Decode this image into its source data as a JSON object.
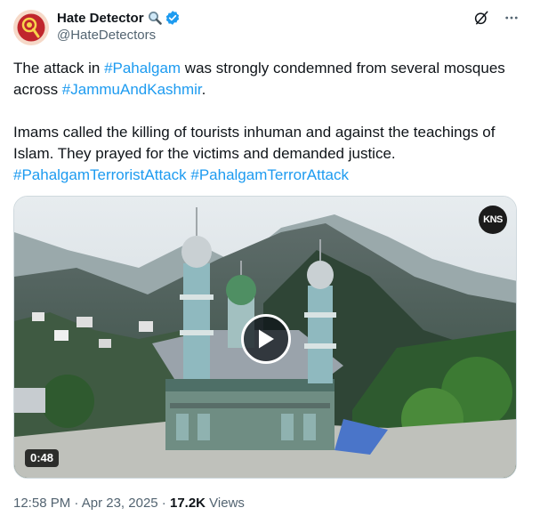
{
  "author": {
    "name": "Hate Detector",
    "handle": "@HateDetectors",
    "name_icon": "magnifier-icon",
    "verified_icon": "verified-badge-icon",
    "avatar_icon": "hate-detector-logo",
    "brand_color": "#c0262d"
  },
  "header_actions": {
    "grok_icon": "grok-icon",
    "more_icon": "more-icon"
  },
  "text": {
    "p1_before": "The attack in ",
    "p1_tag1": "#Pahalgam",
    "p1_mid": " was strongly condemned from several mosques across ",
    "p1_tag2": "#JammuAndKashmir",
    "p1_end": ".",
    "p2": "Imams called the killing of tourists inhuman and against the teachings of Islam. They prayed for the victims and demanded justice.",
    "tag3": "#PahalgamTerroristAttack",
    "tag4": "#PahalgamTerrorAttack"
  },
  "media": {
    "watermark": "KNS",
    "duration": "0:48",
    "play_icon": "play-icon"
  },
  "meta": {
    "time": "12:58 PM",
    "separator": " · ",
    "date": "Apr 23, 2025",
    "views_count": "17.2K",
    "views_label": " Views"
  },
  "colors": {
    "text": "#0f1419",
    "secondary": "#536471",
    "link": "#1d9bf0"
  }
}
